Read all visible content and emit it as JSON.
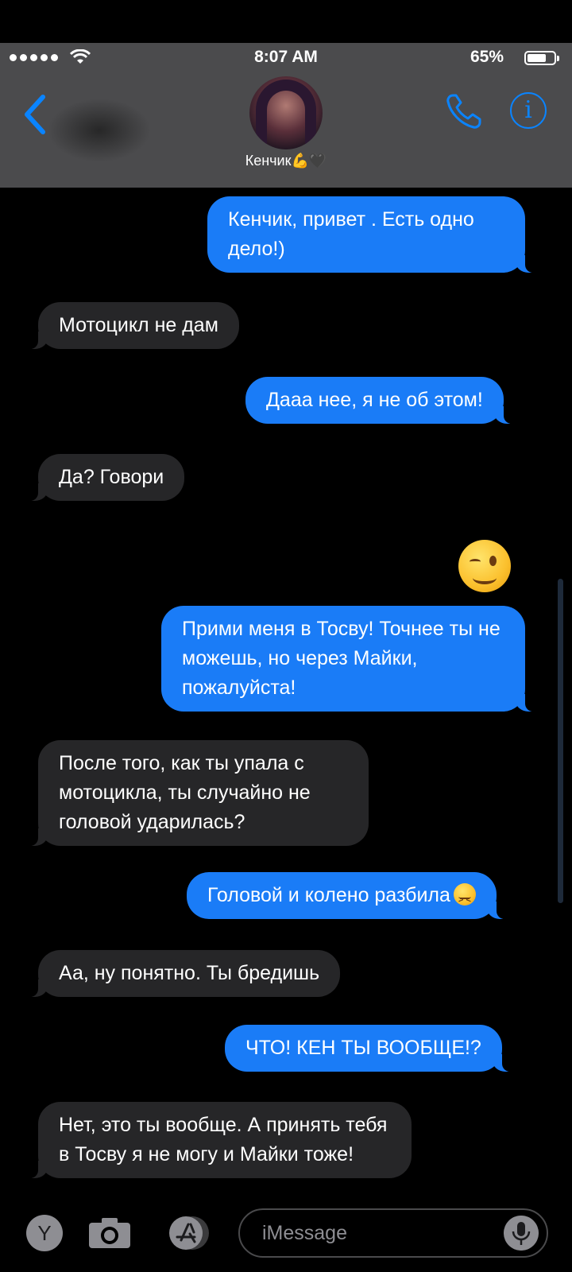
{
  "status_bar": {
    "time": "8:07 AM",
    "battery_percent": "65%",
    "battery_level": 0.65,
    "signal_bars": 5
  },
  "header": {
    "contact_name": "Кенчик💪🖤",
    "back_icon": "chevron-left-icon",
    "call_icon": "phone-icon",
    "info_icon": "info-icon",
    "info_glyph": "i",
    "accent_color": "#0a84ff",
    "background_color": "#4b4b4d"
  },
  "conversation": {
    "outgoing_color": "#1a7cf7",
    "incoming_color": "#262628",
    "messages": [
      {
        "direction": "outgoing",
        "text": "Кенчик, привет . Есть одно дело!)"
      },
      {
        "direction": "incoming",
        "text": "Мотоцикл не дам"
      },
      {
        "direction": "outgoing",
        "text": "Дааа нее, я не об этом!"
      },
      {
        "direction": "incoming",
        "text": "Да? Говори"
      },
      {
        "direction": "outgoing",
        "type": "emoji",
        "emoji": "winking-face"
      },
      {
        "direction": "outgoing",
        "text": "Прими меня в Тосву! Точнее ты не можешь, но через Майки, пожалуйста!"
      },
      {
        "direction": "incoming",
        "text": "После того, как ты упала с мотоцикла, ты случайно не головой ударилась?"
      },
      {
        "direction": "outgoing",
        "text": "Головой и колено разбила",
        "trailing_emoji": "confounded-face"
      },
      {
        "direction": "incoming",
        "text": "Аа, ну понятно. Ты бредишь"
      },
      {
        "direction": "outgoing",
        "text": "ЧТО! КЕН ТЫ ВООБЩЕ!?"
      },
      {
        "direction": "incoming",
        "text": "Нет, это ты вообще. А принять тебя в Тосву я  не могу и Майки тоже!"
      }
    ]
  },
  "composer": {
    "apps_label": "Y",
    "placeholder": "iMessage",
    "camera_icon": "camera-icon",
    "appstore_icon": "app-store-icon",
    "mic_icon": "microphone-icon"
  }
}
